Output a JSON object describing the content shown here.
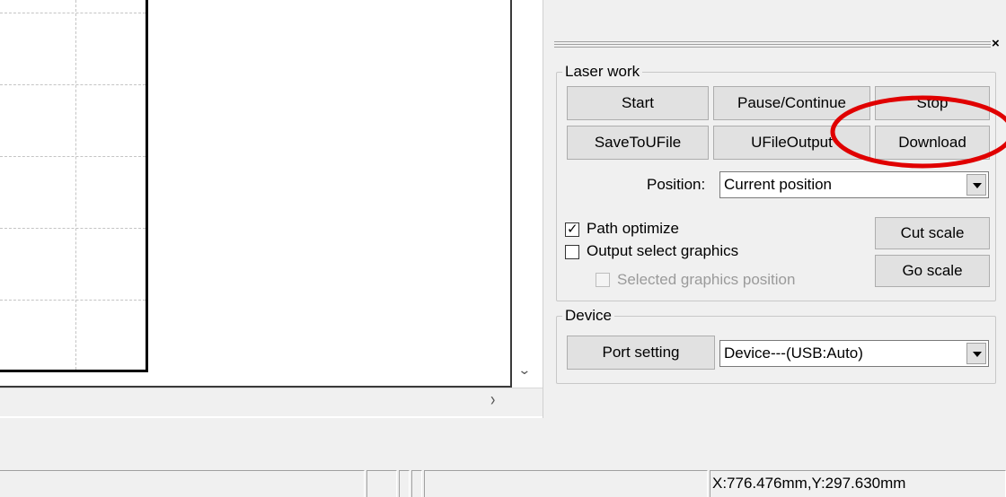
{
  "panel": {
    "close_glyph": "×",
    "laser_work": {
      "legend": "Laser work",
      "start_label": "Start",
      "pause_label": "Pause/Continue",
      "stop_label": "Stop",
      "save_ufile_label": "SaveToUFile",
      "ufile_output_label": "UFileOutput",
      "download_label": "Download",
      "position_label": "Position:",
      "position_value": "Current position",
      "path_optimize_label": "Path optimize",
      "path_optimize_checked": true,
      "output_select_label": "Output select graphics",
      "output_select_checked": false,
      "selected_position_label": "Selected graphics position",
      "selected_position_checked": false,
      "cut_scale_label": "Cut scale",
      "go_scale_label": "Go scale"
    },
    "device": {
      "legend": "Device",
      "port_setting_label": "Port setting",
      "device_value": "Device---(USB:Auto)"
    }
  },
  "annotation": {
    "color": "#e00000"
  },
  "statusbar": {
    "coordinates": "X:776.476mm,Y:297.630mm"
  },
  "icons": {
    "scroll_down": "chevron-down-icon",
    "scroll_right": "chevron-right-icon"
  }
}
